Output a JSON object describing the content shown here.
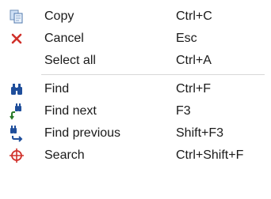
{
  "menu": {
    "items": [
      {
        "label": "Copy",
        "shortcut": "Ctrl+C",
        "icon": "copy-icon"
      },
      {
        "label": "Cancel",
        "shortcut": "Esc",
        "icon": "cancel-icon"
      },
      {
        "label": "Select all",
        "shortcut": "Ctrl+A",
        "icon": ""
      },
      {
        "label": "Find",
        "shortcut": "Ctrl+F",
        "icon": "binoculars-icon"
      },
      {
        "label": "Find next",
        "shortcut": "F3",
        "icon": "find-next-icon"
      },
      {
        "label": "Find previous",
        "shortcut": "Shift+F3",
        "icon": "find-previous-icon"
      },
      {
        "label": "Search",
        "shortcut": "Ctrl+Shift+F",
        "icon": "crosshair-icon"
      }
    ]
  },
  "colors": {
    "icon_blue": "#1f4e9b",
    "icon_red": "#d0302a",
    "separator": "#d8d8d8"
  }
}
